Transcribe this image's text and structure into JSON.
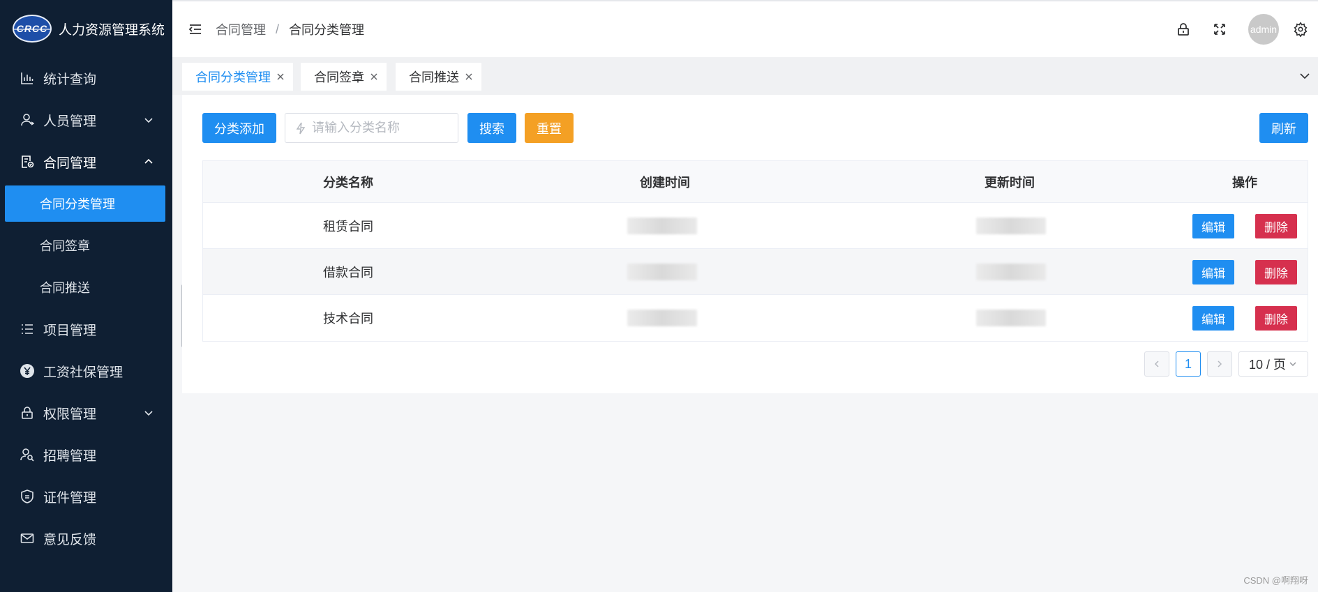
{
  "app": {
    "logo_text": "CRCC",
    "title": "人力资源管理系统"
  },
  "sidebar": {
    "items": [
      {
        "label": "统计查询",
        "icon": "bar-chart-icon"
      },
      {
        "label": "人员管理",
        "icon": "user-icon",
        "expandable": true
      },
      {
        "label": "合同管理",
        "icon": "contract-icon",
        "expandable": true,
        "open": true,
        "children": [
          {
            "label": "合同分类管理",
            "active": true
          },
          {
            "label": "合同签章"
          },
          {
            "label": "合同推送"
          }
        ]
      },
      {
        "label": "项目管理",
        "icon": "list-icon"
      },
      {
        "label": "工资社保管理",
        "icon": "yen-icon"
      },
      {
        "label": "权限管理",
        "icon": "lock-icon",
        "expandable": true
      },
      {
        "label": "招聘管理",
        "icon": "recruit-icon"
      },
      {
        "label": "证件管理",
        "icon": "certificate-icon"
      },
      {
        "label": "意见反馈",
        "icon": "mail-icon"
      }
    ]
  },
  "header": {
    "breadcrumb": [
      "合同管理",
      "合同分类管理"
    ],
    "breadcrumb_sep": "/",
    "avatar_text": "admin"
  },
  "tabs": [
    {
      "label": "合同分类管理",
      "active": true
    },
    {
      "label": "合同签章"
    },
    {
      "label": "合同推送"
    }
  ],
  "toolbar": {
    "add_label": "分类添加",
    "search_placeholder": "请输入分类名称",
    "search_label": "搜索",
    "reset_label": "重置",
    "refresh_label": "刷新"
  },
  "table": {
    "columns": [
      "分类名称",
      "创建时间",
      "更新时间",
      "操作"
    ],
    "rows": [
      {
        "name": "租赁合同"
      },
      {
        "name": "借款合同"
      },
      {
        "name": "技术合同"
      }
    ],
    "edit_label": "编辑",
    "delete_label": "删除"
  },
  "pagination": {
    "current_page": "1",
    "page_size": "10 / 页"
  },
  "watermark": "CSDN @啊翔呀",
  "colors": {
    "primary": "#1f8ef1",
    "warning": "#f4a024",
    "danger": "#d6304e",
    "sidebar_bg": "#0f1f33"
  }
}
